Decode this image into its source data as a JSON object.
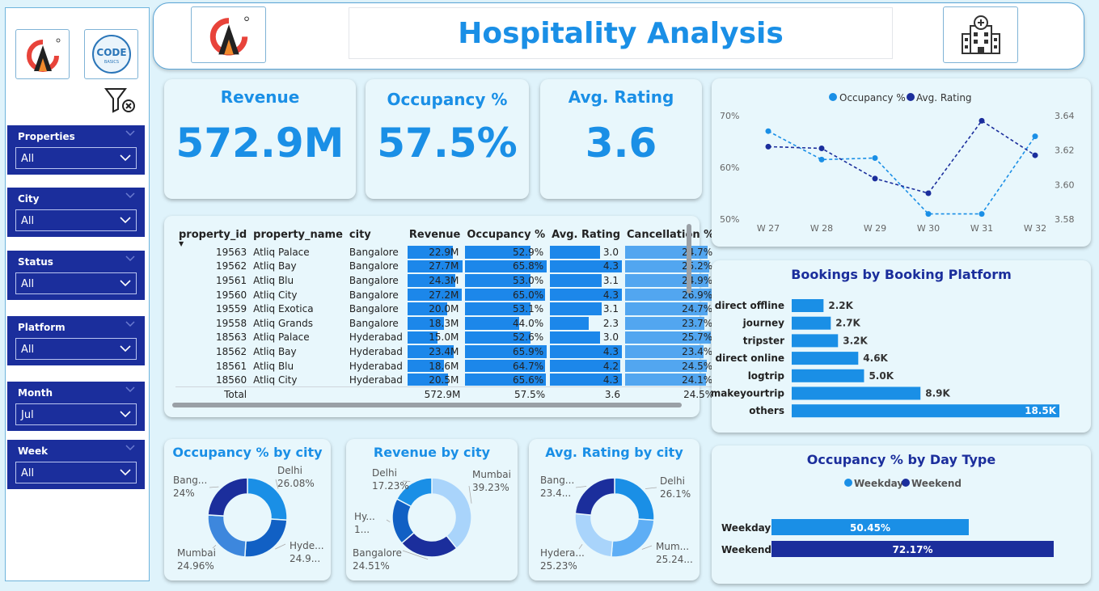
{
  "header": {
    "title": "Hospitality Analysis"
  },
  "sidebar": {
    "logos": [
      "atliq-logo",
      "codebasics-logo"
    ],
    "slicers": [
      {
        "label": "Properties",
        "value": "All"
      },
      {
        "label": "City",
        "value": "All"
      },
      {
        "label": "Status",
        "value": "All"
      },
      {
        "label": "Platform",
        "value": "All"
      },
      {
        "label": "Month",
        "value": "Jul"
      },
      {
        "label": "Week",
        "value": "All"
      }
    ]
  },
  "kpis": {
    "revenue": {
      "title": "Revenue",
      "value": "572.9M"
    },
    "occupancy": {
      "title": "Occupancy %",
      "value": "57.5%"
    },
    "rating": {
      "title": "Avg. Rating",
      "value": "3.6"
    }
  },
  "table": {
    "columns": [
      "property_id",
      "property_name",
      "city",
      "Revenue",
      "Occupancy %",
      "Avg. Rating",
      "Cancellation %"
    ],
    "rows": [
      {
        "id": "19563",
        "name": "Atliq Palace",
        "city": "Bangalore",
        "revenue": "22.9M",
        "rev_num": 22.9,
        "occ": "52.9%",
        "occ_num": 52.9,
        "rating": "3.0",
        "rating_num": 3.0,
        "cancel": "24.7%",
        "cancel_num": 24.7
      },
      {
        "id": "19562",
        "name": "Atliq Bay",
        "city": "Bangalore",
        "revenue": "27.7M",
        "rev_num": 27.7,
        "occ": "65.8%",
        "occ_num": 65.8,
        "rating": "4.3",
        "rating_num": 4.3,
        "cancel": "25.2%",
        "cancel_num": 25.2
      },
      {
        "id": "19561",
        "name": "Atliq Blu",
        "city": "Bangalore",
        "revenue": "24.3M",
        "rev_num": 24.3,
        "occ": "53.0%",
        "occ_num": 53.0,
        "rating": "3.1",
        "rating_num": 3.1,
        "cancel": "24.9%",
        "cancel_num": 24.9
      },
      {
        "id": "19560",
        "name": "Atliq City",
        "city": "Bangalore",
        "revenue": "27.2M",
        "rev_num": 27.2,
        "occ": "65.0%",
        "occ_num": 65.0,
        "rating": "4.3",
        "rating_num": 4.3,
        "cancel": "26.9%",
        "cancel_num": 26.9
      },
      {
        "id": "19559",
        "name": "Atliq Exotica",
        "city": "Bangalore",
        "revenue": "20.0M",
        "rev_num": 20.0,
        "occ": "53.1%",
        "occ_num": 53.1,
        "rating": "3.1",
        "rating_num": 3.1,
        "cancel": "24.7%",
        "cancel_num": 24.7
      },
      {
        "id": "19558",
        "name": "Atliq Grands",
        "city": "Bangalore",
        "revenue": "18.3M",
        "rev_num": 18.3,
        "occ": "44.0%",
        "occ_num": 44.0,
        "rating": "2.3",
        "rating_num": 2.3,
        "cancel": "23.7%",
        "cancel_num": 23.7
      },
      {
        "id": "18563",
        "name": "Atliq Palace",
        "city": "Hyderabad",
        "revenue": "15.0M",
        "rev_num": 15.0,
        "occ": "52.6%",
        "occ_num": 52.6,
        "rating": "3.0",
        "rating_num": 3.0,
        "cancel": "25.7%",
        "cancel_num": 25.7
      },
      {
        "id": "18562",
        "name": "Atliq Bay",
        "city": "Hyderabad",
        "revenue": "23.4M",
        "rev_num": 23.4,
        "occ": "65.9%",
        "occ_num": 65.9,
        "rating": "4.3",
        "rating_num": 4.3,
        "cancel": "23.4%",
        "cancel_num": 23.4
      },
      {
        "id": "18561",
        "name": "Atliq Blu",
        "city": "Hyderabad",
        "revenue": "18.6M",
        "rev_num": 18.6,
        "occ": "64.7%",
        "occ_num": 64.7,
        "rating": "4.2",
        "rating_num": 4.2,
        "cancel": "24.5%",
        "cancel_num": 24.5
      },
      {
        "id": "18560",
        "name": "Atliq City",
        "city": "Hyderabad",
        "revenue": "20.5M",
        "rev_num": 20.5,
        "occ": "65.6%",
        "occ_num": 65.6,
        "rating": "4.3",
        "rating_num": 4.3,
        "cancel": "24.1%",
        "cancel_num": 24.1
      }
    ],
    "total": {
      "label": "Total",
      "revenue": "572.9M",
      "occ": "57.5%",
      "rating": "3.6",
      "cancel": "24.5%"
    }
  },
  "charts": {
    "trend": {
      "type": "line",
      "legend": [
        "Occupancy %",
        "Avg. Rating"
      ],
      "categories": [
        "W 27",
        "W 28",
        "W 29",
        "W 30",
        "W 31",
        "W 32"
      ],
      "y_left_ticks": [
        "70%",
        "60%",
        "50%"
      ],
      "y_right_ticks": [
        "3.64",
        "3.62",
        "3.60",
        "3.58"
      ],
      "series": [
        {
          "name": "Occupancy %",
          "values": [
            67.0,
            61.5,
            61.8,
            51.0,
            51.0,
            66.0
          ],
          "color": "#1a8fe6",
          "ylim": [
            50,
            70
          ]
        },
        {
          "name": "Avg. Rating",
          "values": [
            3.622,
            3.621,
            3.6035,
            3.595,
            3.637,
            3.617
          ],
          "color": "#1b2e9c",
          "ylim": [
            3.58,
            3.64
          ]
        }
      ]
    },
    "platform": {
      "type": "bar",
      "title": "Bookings by Booking Platform",
      "categories": [
        "direct offline",
        "journey",
        "tripster",
        "direct online",
        "logtrip",
        "makeyourtrip",
        "others"
      ],
      "labels": [
        "2.2K",
        "2.7K",
        "3.2K",
        "4.6K",
        "5.0K",
        "8.9K",
        "18.5K"
      ],
      "values": [
        2.2,
        2.7,
        3.2,
        4.6,
        5.0,
        8.9,
        18.5
      ]
    },
    "occ_city": {
      "type": "pie",
      "title": "Occupancy % by city",
      "slices": [
        {
          "label": "Delhi",
          "pct": "26.08%",
          "value": 26.08,
          "color": "#1a8fe6"
        },
        {
          "label": "Hyde...",
          "pct": "24.9...",
          "value": 24.98,
          "color": "#1160c4"
        },
        {
          "label": "Mumbai",
          "pct": "24.96%",
          "value": 24.96,
          "color": "#3d87dd"
        },
        {
          "label": "Bang...",
          "pct": "24%",
          "value": 24.0,
          "color": "#1b2e9c"
        }
      ]
    },
    "rev_city": {
      "type": "pie",
      "title": "Revenue by city",
      "slices": [
        {
          "label": "Mumbai",
          "pct": "39.23%",
          "value": 39.23,
          "color": "#a9d4fb"
        },
        {
          "label": "Bangalore",
          "pct": "24.51%",
          "value": 24.51,
          "color": "#1b2e9c"
        },
        {
          "label": "Hy...",
          "pct": "1...",
          "value": 19.03,
          "color": "#1160c4"
        },
        {
          "label": "Delhi",
          "pct": "17.23%",
          "value": 17.23,
          "color": "#1a8fe6"
        }
      ]
    },
    "rating_city": {
      "type": "pie",
      "title": "Avg. Rating by city",
      "slices": [
        {
          "label": "Delhi",
          "pct": "26.1%",
          "value": 26.1,
          "color": "#1a8fe6"
        },
        {
          "label": "Mum...",
          "pct": "25.24...",
          "value": 25.24,
          "color": "#5eaef5"
        },
        {
          "label": "Hydera...",
          "pct": "25.23%",
          "value": 25.23,
          "color": "#a9d4fb"
        },
        {
          "label": "Bang...",
          "pct": "23.4...",
          "value": 23.43,
          "color": "#1b2e9c"
        }
      ]
    },
    "daytype": {
      "type": "bar",
      "title": "Occupancy % by Day Type",
      "legend": [
        "Weekday",
        "Weekend"
      ],
      "categories": [
        "Weekday",
        "Weekend"
      ],
      "labels": [
        "50.45%",
        "72.17%"
      ],
      "values": [
        50.45,
        72.17
      ],
      "colors": [
        "#1a8fe6",
        "#1b2e9c"
      ]
    }
  }
}
